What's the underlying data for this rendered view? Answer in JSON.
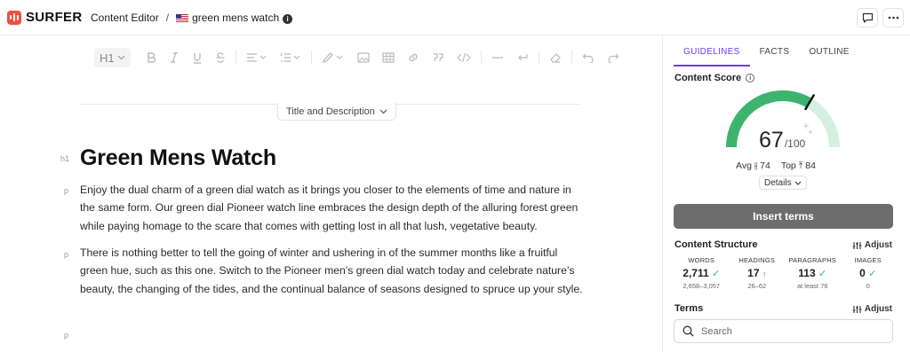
{
  "app": {
    "brand": "SURFER"
  },
  "breadcrumb": {
    "root": "Content Editor",
    "separator": "/",
    "doc": "green mens watch",
    "info": "i"
  },
  "topbar": {
    "comment_icon": "comment-icon",
    "more_icon": "more-icon"
  },
  "toolbar": {
    "heading_label": "H1"
  },
  "editor": {
    "title_desc_label": "Title and Description",
    "h1_tag": "h1",
    "p_tag": "p",
    "title": "Green Mens Watch",
    "paragraphs": [
      "Enjoy the dual charm of a green dial watch as it brings you closer to the elements of time and nature in the same form. Our green dial Pioneer watch line embraces the design depth of the alluring forest green while paying homage to the scare that comes with getting lost in all that lush, vegetative beauty.",
      "There is nothing better to tell the going of winter and ushering in of the summer months like a fruitful green hue, such as this one. Switch to the Pioneer men’s green dial watch today and celebrate nature’s beauty, the changing of the tides, and the continual balance of seasons designed to spruce up your style."
    ]
  },
  "sidebar": {
    "tabs": [
      "GUIDELINES",
      "FACTS",
      "OUTLINE"
    ],
    "content_score": {
      "title": "Content Score",
      "score": "67",
      "max": "/100",
      "score_fraction": 0.67,
      "avg_label": "Avg",
      "avg": "74",
      "top_label": "Top",
      "top": "84",
      "details_label": "Details"
    },
    "insert_terms_label": "Insert terms",
    "structure": {
      "title": "Content Structure",
      "adjust_label": "Adjust",
      "items": [
        {
          "label": "WORDS",
          "value": "2,711",
          "mark": "✓",
          "range": "2,658–3,057"
        },
        {
          "label": "HEADINGS",
          "value": "17",
          "mark": "↑",
          "range": "26–62"
        },
        {
          "label": "PARAGRAPHS",
          "value": "113",
          "mark": "✓",
          "range": "at least 76"
        },
        {
          "label": "IMAGES",
          "value": "0",
          "mark": "✓",
          "range": "0"
        }
      ]
    },
    "terms": {
      "title": "Terms",
      "adjust_label": "Adjust",
      "search_placeholder": "Search"
    }
  },
  "colors": {
    "accent": "#6b3df0",
    "gauge_green": "#3cb46e",
    "gauge_light": "#cfeedd",
    "brand": "#ef4f3a"
  }
}
